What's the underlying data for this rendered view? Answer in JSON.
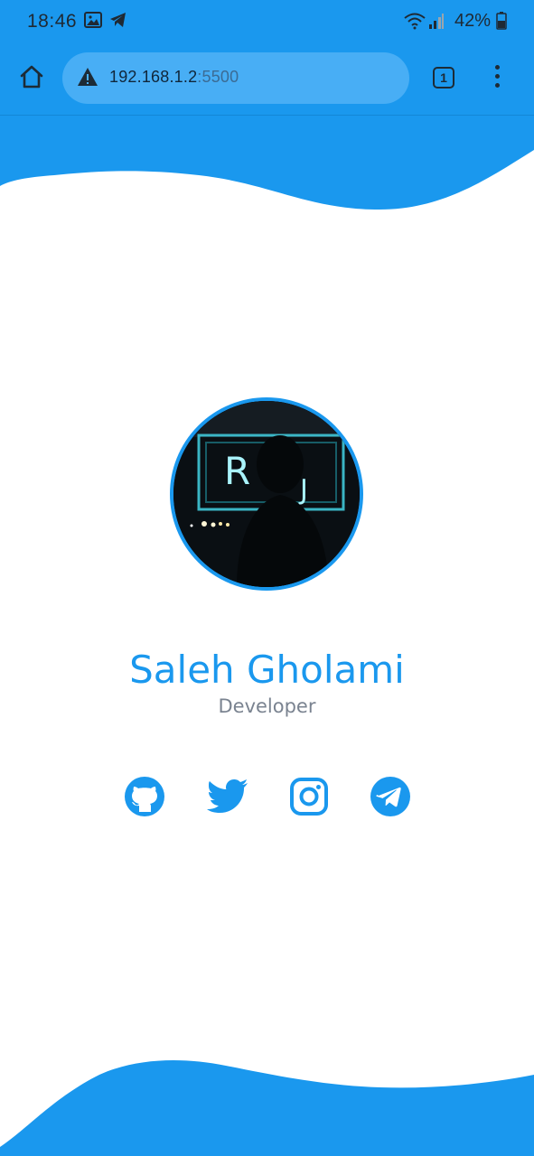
{
  "status_bar": {
    "time": "18:46",
    "battery": "42%",
    "icons": [
      "gallery-icon",
      "telegram-notification-icon",
      "wifi-icon",
      "signal-icon",
      "battery-icon"
    ]
  },
  "browser": {
    "url_host": "192.168.1.2",
    "url_port": ":5500",
    "tab_count": "1",
    "icons": [
      "home-icon",
      "not-secure-warning-icon",
      "tabs-icon",
      "more-menu-icon"
    ]
  },
  "profile": {
    "name": "Saleh Gholami",
    "role": "Developer"
  },
  "socials": [
    {
      "name": "github",
      "icon": "github-icon"
    },
    {
      "name": "twitter",
      "icon": "twitter-icon"
    },
    {
      "name": "instagram",
      "icon": "instagram-icon"
    },
    {
      "name": "telegram",
      "icon": "telegram-icon"
    }
  ],
  "colors": {
    "accent": "#1a98ee",
    "urlbar": "#48aef5",
    "role_text": "#7a8390",
    "background": "#ffffff"
  }
}
